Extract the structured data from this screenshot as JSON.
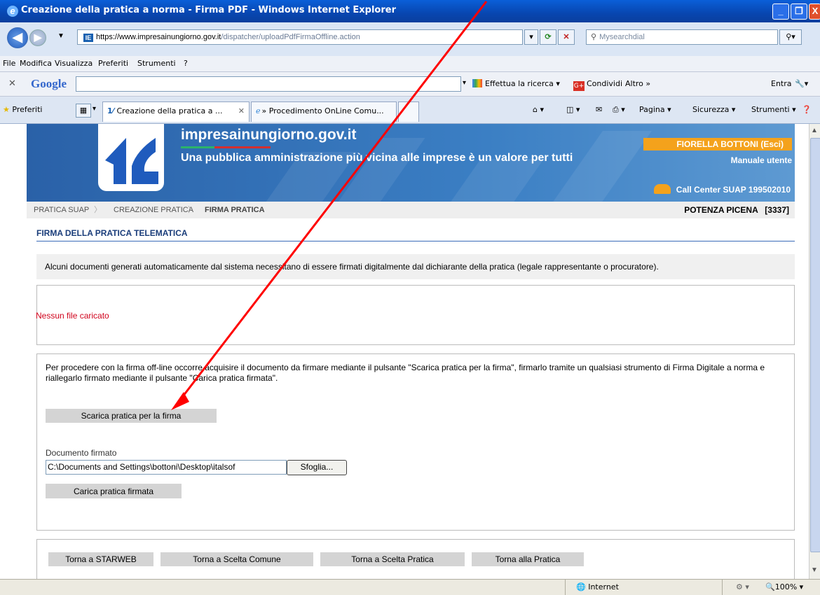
{
  "window": {
    "title": "Creazione della pratica a norma - Firma PDF - Windows Internet Explorer"
  },
  "address": {
    "domain": "https://www.impresainungiorno.gov.it",
    "path": "/dispatcher/uploadPdfFirmaOffline.action"
  },
  "search": {
    "placeholder": "Mysearchdial"
  },
  "menu": [
    "File",
    "Modifica",
    "Visualizza",
    "Preferiti",
    "Strumenti",
    "?"
  ],
  "google_toolbar": {
    "logo": "Google",
    "search_btn": "Effettua la ricerca",
    "share": "Condividi",
    "more": "Altro »",
    "signin": "Entra"
  },
  "favorites": {
    "label": "Preferiti",
    "tab1": "Creazione della pratica a ...",
    "tab2": "» Procedimento OnLine Comu...",
    "tools": {
      "page": "Pagina",
      "security": "Sicurezza",
      "tools": "Strumenti"
    }
  },
  "header": {
    "site": "impresainungiorno.gov.it",
    "slogan": "Una pubblica amministrazione più vicina alle imprese è un valore per tutti",
    "user": "FIORELLA BOTTONI (Esci)",
    "manual": "Manuale utente",
    "call_center": "Call Center SUAP 199502010"
  },
  "breadcrumb": {
    "items": [
      "PRATICA SUAP",
      "CREAZIONE PRATICA",
      "FIRMA PRATICA"
    ],
    "comune": "POTENZA PICENA   [3337]"
  },
  "section": {
    "title": "FIRMA DELLA PRATICA TELEMATICA",
    "info": "Alcuni documenti generati automaticamente dal sistema necessitano di essere firmati digitalmente dal dichiarante della pratica (legale rappresentante o procuratore).",
    "message": "Nessun file caricato",
    "instructions": "Per procedere con la firma off-line occorre acquisire il documento da firmare mediante il pulsante \"Scarica pratica per la firma\", firmarlo tramite un qualsiasi strumento di Firma Digitale a norma e riallegarlo firmato mediante il pulsante \"Carica pratica firmata\".",
    "download_btn": "Scarica pratica per la firma",
    "doc_label": "Documento firmato",
    "file_value": "C:\\Documents and Settings\\bottoni\\Desktop\\italsof",
    "browse_btn": "Sfoglia...",
    "upload_btn": "Carica pratica firmata"
  },
  "nav_buttons": [
    "Torna a STARWEB",
    "Torna a Scelta Comune",
    "Torna a Scelta Pratica",
    "Torna alla Pratica"
  ],
  "status": {
    "zone": "Internet",
    "zoom": "100%"
  },
  "colors": {
    "accent": "#3b7fc4",
    "orange": "#f4a21c",
    "error": "#d0021b",
    "annotation_arrow": "#ff0000"
  }
}
